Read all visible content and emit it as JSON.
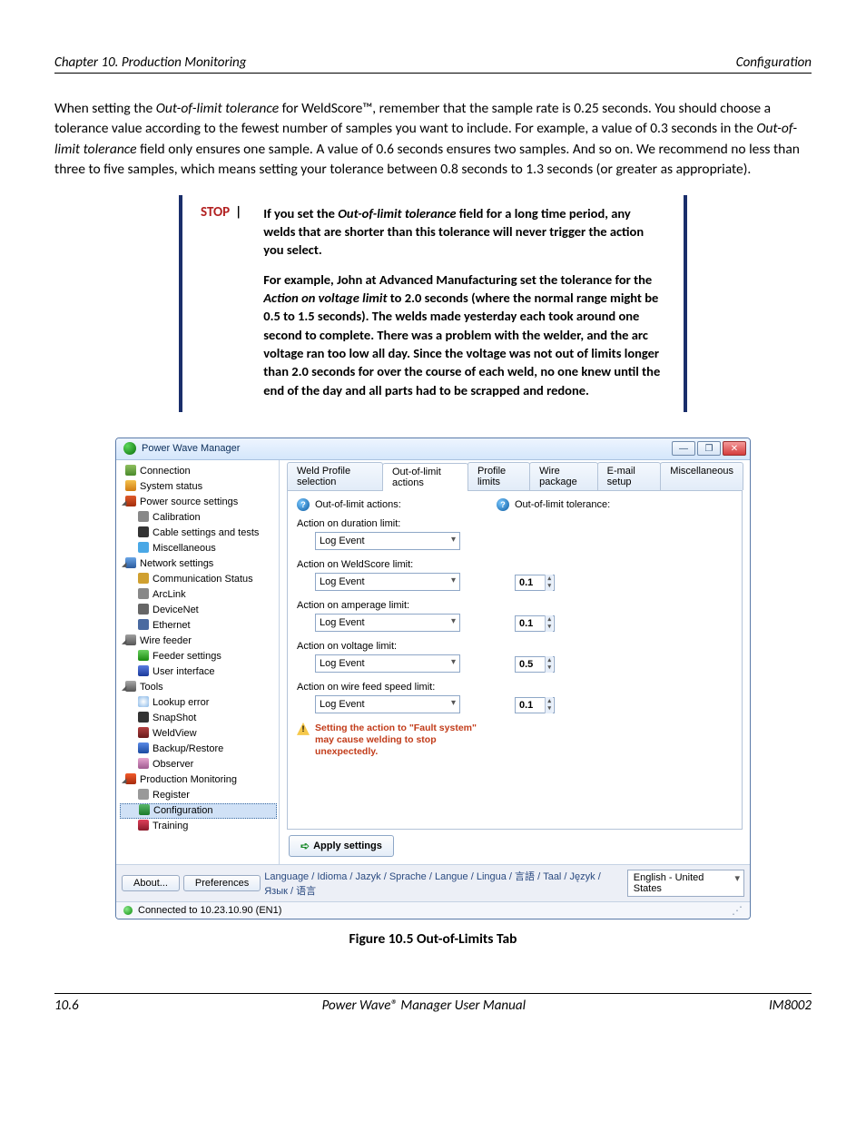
{
  "header": {
    "left": "Chapter 10. Production Monitoring",
    "right": "Configuration"
  },
  "paragraph_parts": {
    "pre": "When setting the ",
    "em1": "Out-of-limit tolerance",
    "mid1": " for WeldScore™, remember that the sample rate is 0.25 seconds. You should choose a tolerance value according to the fewest number of samples you want to include.  For example, a value of 0.3 seconds in the ",
    "em2": "Out-of-limit tolerance",
    "post": " field only ensures one sample.  A value of 0.6 seconds ensures two samples.  And so on.  We recommend no less than three to five samples, which means setting your tolerance between 0.8 seconds to 1.3 seconds (or greater as appropriate)."
  },
  "stop": {
    "label": "STOP",
    "p1": {
      "pre": "If you set the ",
      "em": "Out-of-limit tolerance",
      "post": " field for a long time period, any welds that are shorter than this tolerance will never trigger the action you select."
    },
    "p2": {
      "pre": "For example, John at Advanced Manufacturing set the tolerance for the ",
      "em": "Action on voltage limit",
      "post": " to 2.0 seconds (where the normal range might be 0.5 to 1.5 seconds).  The welds made yesterday each took around one second to complete.  There was a problem with the welder, and the arc voltage ran too low all day.  Since the voltage was not out of limits longer than 2.0 seconds for over the course of each weld, no one knew until the end of the day and all parts had to be scrapped and redone."
    }
  },
  "window": {
    "title": "Power Wave Manager",
    "min": "—",
    "max": "❐",
    "close": "✕",
    "tree": {
      "connection": "Connection",
      "system_status": "System status",
      "power_source": "Power source settings",
      "calibration": "Calibration",
      "cable": "Cable settings and tests",
      "misc": "Miscellaneous",
      "network": "Network settings",
      "comm": "Communication Status",
      "arclink": "ArcLink",
      "devicenet": "DeviceNet",
      "ethernet": "Ethernet",
      "wire_feeder": "Wire feeder",
      "feeder_settings": "Feeder settings",
      "ui": "User interface",
      "tools": "Tools",
      "lookup": "Lookup error",
      "snapshot": "SnapShot",
      "weldview": "WeldView",
      "backup": "Backup/Restore",
      "observer": "Observer",
      "prod_mon": "Production Monitoring",
      "register": "Register",
      "configuration": "Configuration",
      "training": "Training"
    },
    "tabs": {
      "t1": "Weld Profile selection",
      "t2": "Out-of-limit actions",
      "t3": "Profile limits",
      "t4": "Wire package",
      "t5": "E-mail setup",
      "t6": "Miscellaneous"
    },
    "help": {
      "actions": "Out-of-limit actions:",
      "tolerance": "Out-of-limit tolerance:"
    },
    "labels": {
      "duration": "Action on duration limit:",
      "weldscore": "Action on WeldScore limit:",
      "amperage": "Action on amperage limit:",
      "voltage": "Action on voltage limit:",
      "wirefeed": "Action on wire feed speed limit:"
    },
    "dropdown_value": "Log Event",
    "spins": {
      "weldscore": "0.1",
      "amperage": "0.1",
      "voltage": "0.5",
      "wirefeed": "0.1"
    },
    "warning": "Setting the action to \"Fault system\" may cause welding to stop unexpectedly.",
    "apply": "Apply settings",
    "bottom": {
      "about": "About...",
      "preferences": "Preferences",
      "lang_label": "Language / Idioma / Jazyk / Sprache / Langue / Lingua / 言語 / Taal / Język / Язык / 语言",
      "lang_value": "English - United States"
    },
    "status": "Connected to 10.23.10.90 (EN1)"
  },
  "figure_caption": "Figure 10.5   Out-of-Limits Tab",
  "footer": {
    "left": "10.6",
    "center": "Power Wave® Manager User Manual",
    "right": "IM8002"
  }
}
